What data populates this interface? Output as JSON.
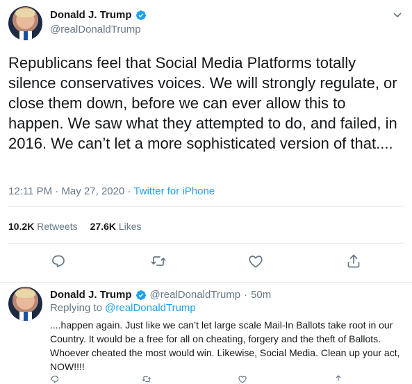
{
  "tweet": {
    "author_name": "Donald J. Trump",
    "author_handle": "@realDonaldTrump",
    "text": "Republicans feel that Social Media Platforms totally silence conservatives voices. We will strongly regulate, or close them down, before we can ever allow this to happen. We saw what they attempted to do, and failed, in 2016. We can’t let a more sophisticated version of that....",
    "time": "12:11 PM",
    "separator": "·",
    "date": "May 27, 2020",
    "source": "Twitter for iPhone",
    "retweets_count": "10.2K",
    "retweets_label": "Retweets",
    "likes_count": "27.6K",
    "likes_label": "Likes"
  },
  "reply": {
    "author_name": "Donald J. Trump",
    "author_handle": "@realDonaldTrump",
    "separator": "·",
    "age": "50m",
    "replying_prefix": "Replying to",
    "replying_to": "@realDonaldTrump",
    "text": "....happen again. Just like we can’t let large scale Mail-In Ballots take root in our Country. It would be a free for all on cheating, forgery and the theft of Ballots. Whoever cheated the most would win. Likewise, Social Media. Clean up your act, NOW!!!!"
  },
  "icons": {
    "verified": "verified-badge-icon",
    "menu": "chevron-down-icon",
    "reply": "reply-icon",
    "retweet": "retweet-icon",
    "like": "heart-icon",
    "share": "share-icon"
  },
  "colors": {
    "accent": "#1da1f2",
    "text": "#14171a",
    "secondary": "#657786",
    "divider": "#e6ecf0"
  }
}
